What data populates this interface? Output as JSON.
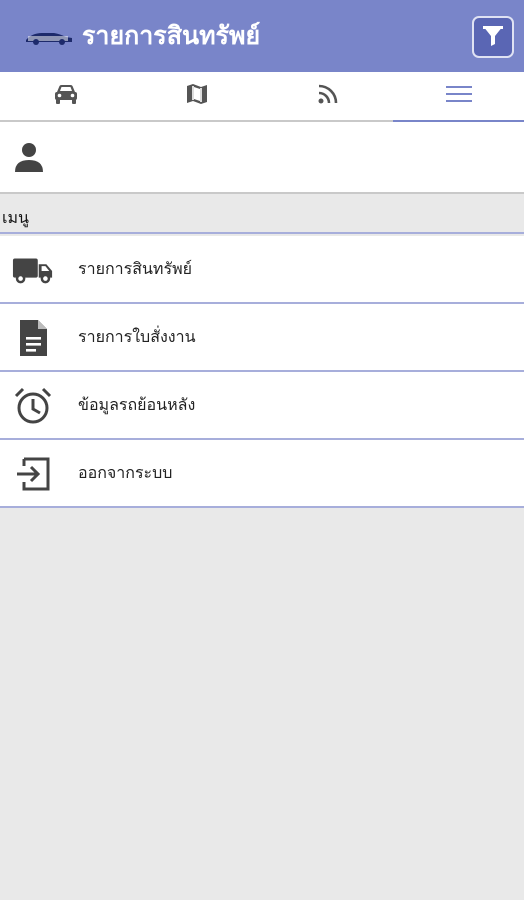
{
  "header": {
    "title": "รายการสินทรัพย์",
    "logo_icon": "car-logo-icon",
    "filter_icon": "filter-icon",
    "background": "#7985c9"
  },
  "tabs": [
    {
      "icon": "car-icon",
      "active": false
    },
    {
      "icon": "map-icon",
      "active": false
    },
    {
      "icon": "rss-icon",
      "active": false
    },
    {
      "icon": "menu-icon",
      "active": true
    }
  ],
  "profile": {
    "icon": "person-icon"
  },
  "menu": {
    "section_label": "เมนู",
    "items": [
      {
        "label": "รายการสินทรัพย์",
        "icon": "truck-icon"
      },
      {
        "label": "รายการใบสั่งงาน",
        "icon": "document-icon"
      },
      {
        "label": "ข้อมูลรถย้อนหลัง",
        "icon": "alarm-clock-icon"
      },
      {
        "label": "ออกจากระบบ",
        "icon": "logout-icon"
      }
    ]
  }
}
